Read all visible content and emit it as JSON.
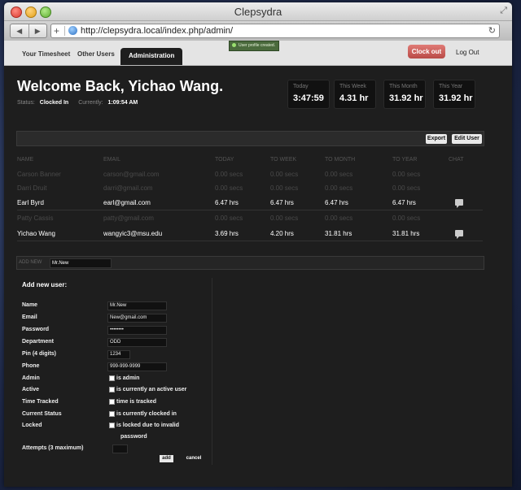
{
  "window": {
    "title": "Clepsydra"
  },
  "browser": {
    "url": "http://clepsydra.local/index.php/admin/"
  },
  "nav": {
    "tabs": [
      "Your Timesheet",
      "Other Users",
      "Administration"
    ],
    "clock_out": "Clock out",
    "log_out": "Log Out"
  },
  "toast": "User profile created.",
  "welcome": {
    "title": "Welcome Back, Yichao Wang.",
    "status_label": "Status:",
    "status_value": "Clocked In",
    "current_label": "Currently:",
    "current_value": "1:09:54 AM"
  },
  "stats": [
    {
      "label": "Today",
      "value": "3:47:59"
    },
    {
      "label": "This Week",
      "value": "4.31 hr"
    },
    {
      "label": "This Month",
      "value": "31.92 hr"
    },
    {
      "label": "This Year",
      "value": "31.92 hr"
    }
  ],
  "table": {
    "export_label": "Export",
    "edit_label": "Edit User",
    "columns": [
      "NAME",
      "EMAIL",
      "TODAY",
      "TO WEEK",
      "TO MONTH",
      "TO YEAR",
      "CHAT"
    ],
    "rows": [
      {
        "name": "Carson Banner",
        "email": "carson@gmail.com",
        "today": "0.00 secs",
        "week": "0.00 secs",
        "month": "0.00 secs",
        "year": "0.00 secs"
      },
      {
        "name": "Darri Druit",
        "email": "darri@gmail.com",
        "today": "0.00 secs",
        "week": "0.00 secs",
        "month": "0.00 secs",
        "year": "0.00 secs"
      },
      {
        "name": "Earl Byrd",
        "email": "earl@gmail.com",
        "today": "6.47 hrs",
        "week": "6.47 hrs",
        "month": "6.47 hrs",
        "year": "6.47 hrs"
      },
      {
        "name": "Patty Cassis",
        "email": "patty@gmail.com",
        "today": "0.00 secs",
        "week": "0.00 secs",
        "month": "0.00 secs",
        "year": "0.00 secs"
      },
      {
        "name": "Yichao Wang",
        "email": "wangyic3@msu.edu",
        "today": "3.69 hrs",
        "week": "4.20 hrs",
        "month": "31.81 hrs",
        "year": "31.81 hrs"
      }
    ]
  },
  "add_bar": {
    "label": "ADD NEW",
    "value": "Mr.New"
  },
  "form": {
    "title": "Add new user:",
    "name_label": "Name",
    "name_value": "Mr.New",
    "email_label": "Email",
    "email_value": "New@gmail.com",
    "password_label": "Password",
    "password_value": "••••••••",
    "department_label": "Department",
    "department_value": "ODD",
    "pin_label": "Pin (4 digits)",
    "pin_value": "1234",
    "phone_label": "Phone",
    "phone_value": "999-999-9999",
    "admin_label": "Admin",
    "admin_text": "is admin",
    "active_label": "Active",
    "active_text": "is currently an active user",
    "time_label": "Time Tracked",
    "time_text": "time is tracked",
    "current_label": "Current Status",
    "current_text": "is currently clocked in",
    "locked_label": "Locked",
    "locked_text_1": "is locked due to invalid",
    "locked_text_2": "password",
    "attempts_label": "Attempts (3 maximum)",
    "add_label": "add",
    "cancel_label": "cancel"
  }
}
